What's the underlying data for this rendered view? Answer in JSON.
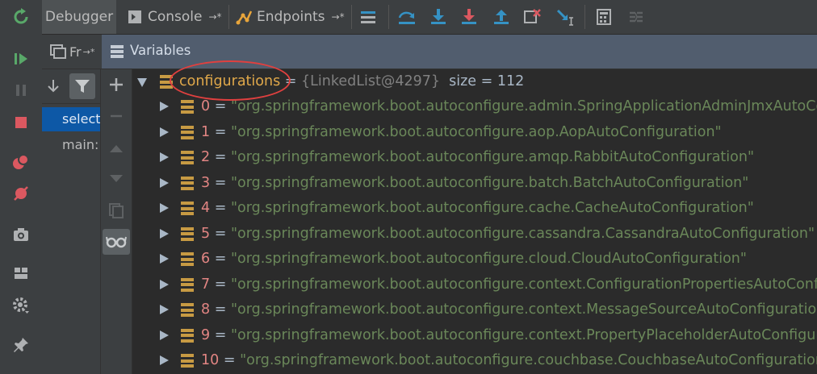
{
  "toolbar": {
    "tabs": [
      {
        "label": "Debugger"
      },
      {
        "label": "Console",
        "suffix": "→*"
      },
      {
        "label": "Endpoints",
        "suffix": "→*"
      }
    ]
  },
  "sub_header": {
    "frames_label": "Fr",
    "frames_suffix": "→*",
    "variables_label": "Variables"
  },
  "frames": [
    {
      "label": "select",
      "selected": true
    },
    {
      "label": "main:",
      "selected": false
    }
  ],
  "variables": {
    "root": {
      "name": "configurations",
      "eq": " = ",
      "type": "{LinkedList@4297}",
      "size": "size = 112"
    },
    "items": [
      {
        "index": "0",
        "value": "\"org.springframework.boot.autoconfigure.admin.SpringApplicationAdminJmxAutoConfiguration\""
      },
      {
        "index": "1",
        "value": "\"org.springframework.boot.autoconfigure.aop.AopAutoConfiguration\""
      },
      {
        "index": "2",
        "value": "\"org.springframework.boot.autoconfigure.amqp.RabbitAutoConfiguration\""
      },
      {
        "index": "3",
        "value": "\"org.springframework.boot.autoconfigure.batch.BatchAutoConfiguration\""
      },
      {
        "index": "4",
        "value": "\"org.springframework.boot.autoconfigure.cache.CacheAutoConfiguration\""
      },
      {
        "index": "5",
        "value": "\"org.springframework.boot.autoconfigure.cassandra.CassandraAutoConfiguration\""
      },
      {
        "index": "6",
        "value": "\"org.springframework.boot.autoconfigure.cloud.CloudAutoConfiguration\""
      },
      {
        "index": "7",
        "value": "\"org.springframework.boot.autoconfigure.context.ConfigurationPropertiesAutoConfiguration\""
      },
      {
        "index": "8",
        "value": "\"org.springframework.boot.autoconfigure.context.MessageSourceAutoConfiguration\""
      },
      {
        "index": "9",
        "value": "\"org.springframework.boot.autoconfigure.context.PropertyPlaceholderAutoConfiguration\""
      },
      {
        "index": "10",
        "value": "\"org.springframework.boot.autoconfigure.couchbase.CouchbaseAutoConfiguration\""
      }
    ],
    "eq": " = "
  },
  "colors": {
    "accent_selection": "#0d58a6",
    "highlight_circle": "#e0403f",
    "string_value": "#6a8759",
    "index_name": "#e28583",
    "root_name": "#e0a84a",
    "field_icon": "#c79a43"
  }
}
